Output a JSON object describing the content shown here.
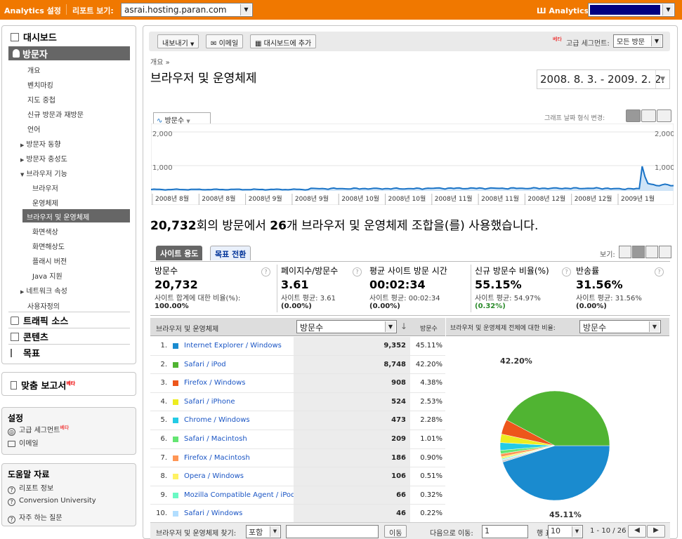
{
  "topbar": {
    "analytics_settings": "Analytics 설정",
    "report_view_label": "리포트 보기:",
    "report_site": "asrai.hosting.paran.com",
    "account_label": "Analytics 계정:"
  },
  "sidebar": {
    "dashboard": "대시보드",
    "visitors": "방문자",
    "items": [
      "개요",
      "벤치마킹",
      "지도 중첩",
      "신규 방문과 재방문",
      "언어",
      "방문자 동향",
      "방문자 충성도",
      "브라우저 기능"
    ],
    "browser_sub": [
      "브라우저",
      "운영체제",
      "브라우저 및 운영체제",
      "화면색상",
      "화면해상도",
      "플래시 버전",
      "Java 지원"
    ],
    "network": "네트워크 속성",
    "user_defined": "사용자정의",
    "traffic_sources": "트래픽 소스",
    "content": "콘텐츠",
    "goals": "목표",
    "custom_reports": "맞춤 보고서",
    "beta": "베타",
    "settings_title": "설정",
    "advanced_segments": "고급 세그먼트",
    "email": "이메일",
    "help_title": "도움말 자료",
    "help_items": [
      "리포트 정보",
      "Conversion University",
      "자주 하는 질문"
    ]
  },
  "toolbar": {
    "export": "내보내기",
    "email": "이메일",
    "add_dashboard": "대시보드에 추가",
    "beta": "베타",
    "advanced_segment_label": "고급 세그먼트:",
    "segment_value": "모든 방문"
  },
  "breadcrumb": "개요 »",
  "page_title": "브라우저 및 운영체제",
  "date_range": "2008. 8. 3. - 2009. 2. 2.",
  "graph": {
    "metric_tab": "방문수",
    "mode_label": "그래프 날짜 형식 변경:",
    "y_top": "2,000",
    "y_mid": "1,000",
    "x_labels": [
      "2008년 8월",
      "2008년 8월",
      "2008년 9월",
      "2008년 9월",
      "2008년 10월",
      "2008년 10월",
      "2008년 11월",
      "2008년 11월",
      "2008년 12월",
      "2008년 12월",
      "2009년 1월"
    ]
  },
  "summary": {
    "visits": "20,732",
    "pre": "회의 방문에서 ",
    "combos": "26",
    "post": "개 브라우저 및 운영체제 조합을(를) 사용했습니다."
  },
  "tabs": {
    "site_usage": "사이트 용도",
    "goal_conversion": "목표 전환",
    "view_label": "보기:"
  },
  "stats": [
    {
      "title": "방문수",
      "value": "20,732",
      "sub1": "사이트 합계에 대한 비율(%):",
      "sub2": "100.00%"
    },
    {
      "title": "페이지수/방문수",
      "value": "3.61",
      "sub1": "사이트 평균: 3.61",
      "sub2": "(0.00%)"
    },
    {
      "title": "평균 사이트 방문 시간",
      "value": "00:02:34",
      "sub1": "사이트 평균: 00:02:34",
      "sub2": "(0.00%)"
    },
    {
      "title": "신규 방문수 비율(%)",
      "value": "55.15%",
      "sub1": "사이트 평균: 54.97%",
      "sub2": "(0.32%)"
    },
    {
      "title": "반송률",
      "value": "31.56%",
      "sub1": "사이트 평균: 31.56%",
      "sub2": "(0.00%)"
    }
  ],
  "table": {
    "col_name": "브라우저 및 운영체제",
    "col_metric": "방문수",
    "col_pct": "방문수",
    "pie_label": "브라우저 및 운영체제 전체에 대한 비율:",
    "pie_metric": "방문수",
    "rows": [
      {
        "idx": "1.",
        "name": "Internet Explorer / Windows",
        "value": "9,352",
        "pct": "45.11%",
        "color": "#1a8bcf"
      },
      {
        "idx": "2.",
        "name": "Safari / iPod",
        "value": "8,748",
        "pct": "42.20%",
        "color": "#50b432"
      },
      {
        "idx": "3.",
        "name": "Firefox / Windows",
        "value": "908",
        "pct": "4.38%",
        "color": "#ed561b"
      },
      {
        "idx": "4.",
        "name": "Safari / iPhone",
        "value": "524",
        "pct": "2.53%",
        "color": "#eded20"
      },
      {
        "idx": "5.",
        "name": "Chrome / Windows",
        "value": "473",
        "pct": "2.28%",
        "color": "#24cbe5"
      },
      {
        "idx": "6.",
        "name": "Safari / Macintosh",
        "value": "209",
        "pct": "1.01%",
        "color": "#64e572"
      },
      {
        "idx": "7.",
        "name": "Firefox / Macintosh",
        "value": "186",
        "pct": "0.90%",
        "color": "#ff9655"
      },
      {
        "idx": "8.",
        "name": "Opera / Windows",
        "value": "106",
        "pct": "0.51%",
        "color": "#fff263"
      },
      {
        "idx": "9.",
        "name": "Mozilla Compatible Agent / iPod",
        "value": "66",
        "pct": "0.32%",
        "color": "#6af9c4"
      },
      {
        "idx": "10.",
        "name": "Safari / Windows",
        "value": "46",
        "pct": "0.22%",
        "color": "#b2deff"
      }
    ],
    "pie_labels": {
      "big": "42.20%",
      "biggest": "45.11%"
    }
  },
  "footer": {
    "search_label": "브라우저 및 운영체제 찾기:",
    "match": "포함",
    "go": "이동",
    "goto_label": "다음으로 이동:",
    "page": "1",
    "rows_label": "행 표시:",
    "rows": "10",
    "range": "1 - 10 / 26"
  }
}
